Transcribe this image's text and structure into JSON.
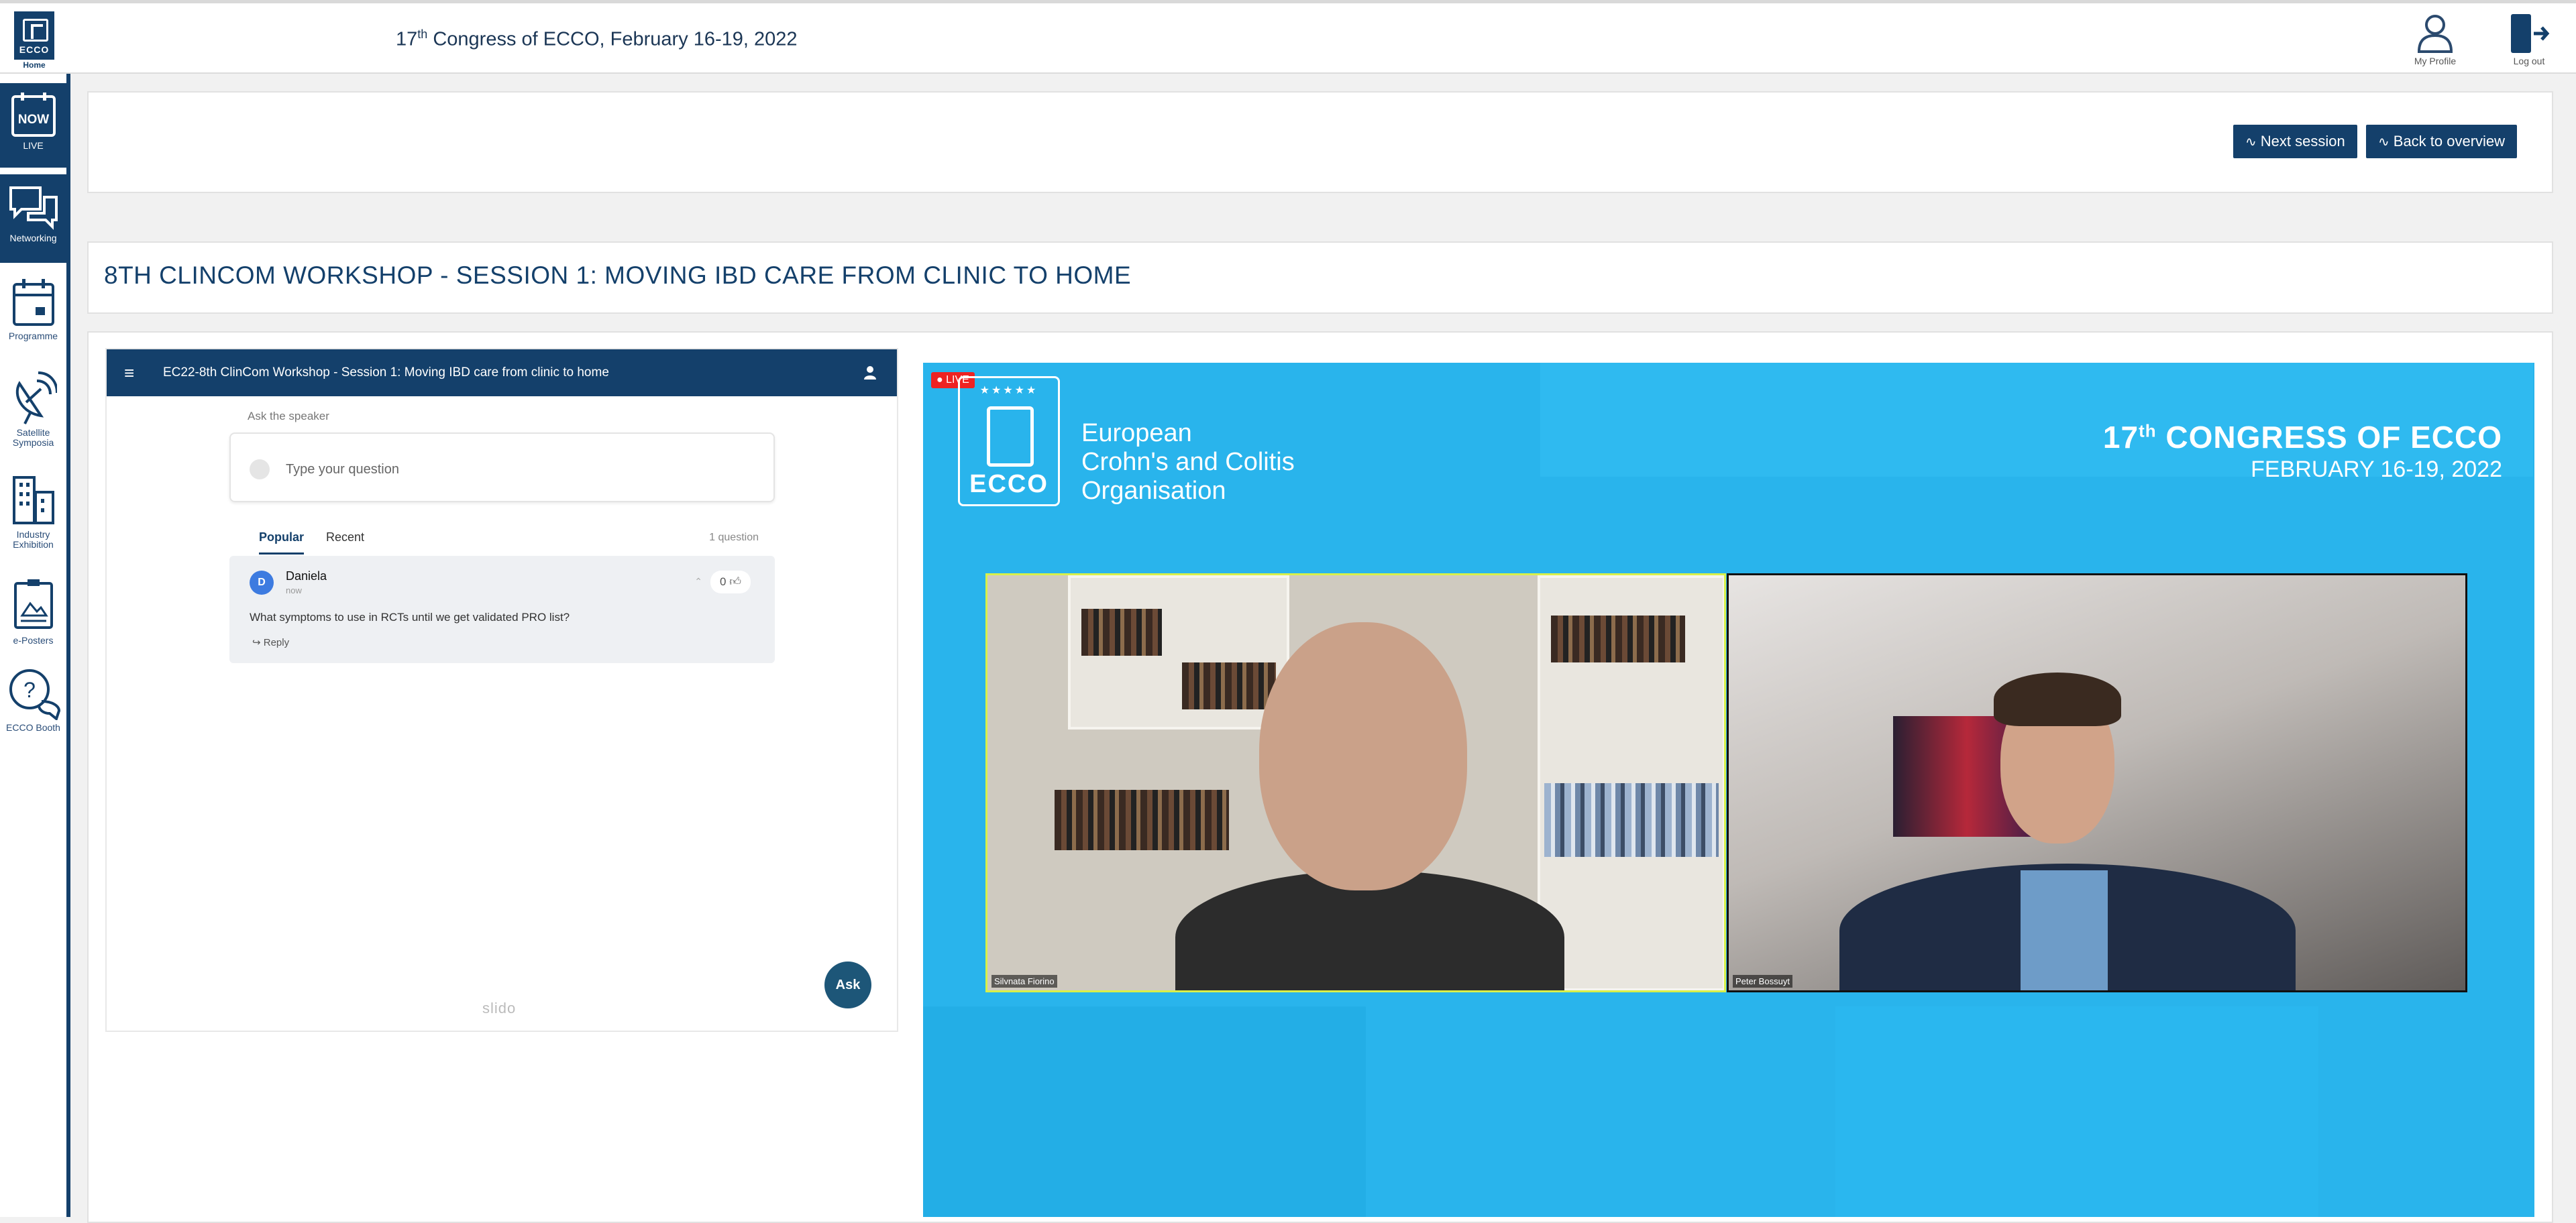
{
  "header": {
    "logo_text": "ECCO",
    "logo_caption": "Home",
    "congress_title_prefix": "17",
    "congress_title_sup": "th",
    "congress_title_rest": " Congress of ECCO, February 16-19, 2022",
    "my_profile": "My Profile",
    "log_out": "Log out"
  },
  "sidebar": {
    "items": [
      {
        "label": "LIVE",
        "icon": "now-calendar-icon",
        "badge": "NOW"
      },
      {
        "label": "Networking",
        "icon": "chat-bubbles-icon"
      },
      {
        "label": "Programme",
        "icon": "calendar-icon"
      },
      {
        "label": "Satellite Symposia",
        "icon": "satellite-dish-icon"
      },
      {
        "label": "Industry Exhibition",
        "icon": "buildings-icon"
      },
      {
        "label": "e-Posters",
        "icon": "poster-board-icon"
      },
      {
        "label": "ECCO Booth",
        "icon": "question-bubbles-icon"
      }
    ]
  },
  "actions": {
    "next_session": "Next session",
    "back_to_overview": "Back to overview"
  },
  "session": {
    "title": "8TH CLINCOM WORKSHOP - SESSION 1: MOVING IBD CARE FROM CLINIC TO HOME"
  },
  "slido": {
    "event_name": "EC22-8th ClinCom Workshop - Session 1: Moving IBD care from clinic to home",
    "ask_label": "Ask the speaker",
    "question_placeholder": "Type your question",
    "tabs": [
      "Popular",
      "Recent"
    ],
    "question_count": "1 question",
    "questions": [
      {
        "initial": "D",
        "author": "Daniela",
        "time": "now",
        "votes": "0",
        "text": "What symptoms to use in RCTs until we get validated PRO list?",
        "reply": "Reply"
      }
    ],
    "ask_button": "Ask",
    "brand": "slido"
  },
  "video": {
    "live_badge": "LIVE",
    "logo_word": "ECCO",
    "org_name_lines": [
      "European",
      "Crohn's and Colitis",
      "Organisation"
    ],
    "congress_line1_num": "17",
    "congress_line1_sup": "th",
    "congress_line1_rest": " CONGRESS OF ECCO",
    "congress_line2": "FEBRUARY 16-19, 2022",
    "speakers": [
      "Silvnata Fiorino",
      "Peter Bossuyt"
    ]
  },
  "colors": {
    "brand_navy": "#14406b",
    "video_blue": "#29b4ec",
    "live_red": "#e22222",
    "active_speaker_border": "#d8f04a"
  }
}
